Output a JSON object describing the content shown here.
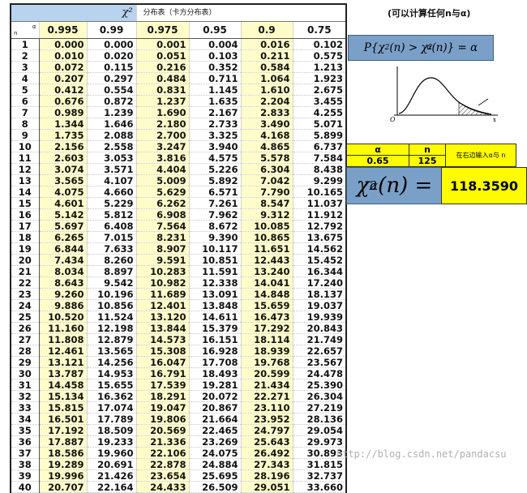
{
  "table": {
    "title_symbol": "χ²",
    "title_text": "分布表（卡方分布表）",
    "header_alpha": "α",
    "header_n": "n",
    "alphas": [
      "0.995",
      "0.99",
      "0.975",
      "0.95",
      "0.9",
      "0.75"
    ],
    "rows": [
      [
        "1",
        "0.000",
        "0.000",
        "0.001",
        "0.004",
        "0.016",
        "0.102"
      ],
      [
        "2",
        "0.010",
        "0.020",
        "0.051",
        "0.103",
        "0.211",
        "0.575"
      ],
      [
        "3",
        "0.072",
        "0.115",
        "0.216",
        "0.352",
        "0.584",
        "1.213"
      ],
      [
        "4",
        "0.207",
        "0.297",
        "0.484",
        "0.711",
        "1.064",
        "1.923"
      ],
      [
        "5",
        "0.412",
        "0.554",
        "0.831",
        "1.145",
        "1.610",
        "2.675"
      ],
      [
        "6",
        "0.676",
        "0.872",
        "1.237",
        "1.635",
        "2.204",
        "3.455"
      ],
      [
        "7",
        "0.989",
        "1.239",
        "1.690",
        "2.167",
        "2.833",
        "4.255"
      ],
      [
        "8",
        "1.344",
        "1.646",
        "2.180",
        "2.733",
        "3.490",
        "5.071"
      ],
      [
        "9",
        "1.735",
        "2.088",
        "2.700",
        "3.325",
        "4.168",
        "5.899"
      ],
      [
        "10",
        "2.156",
        "2.558",
        "3.247",
        "3.940",
        "4.865",
        "6.737"
      ],
      [
        "11",
        "2.603",
        "3.053",
        "3.816",
        "4.575",
        "5.578",
        "7.584"
      ],
      [
        "12",
        "3.074",
        "3.571",
        "4.404",
        "5.226",
        "6.304",
        "8.438"
      ],
      [
        "13",
        "3.565",
        "4.107",
        "5.009",
        "5.892",
        "7.042",
        "9.299"
      ],
      [
        "14",
        "4.075",
        "4.660",
        "5.629",
        "6.571",
        "7.790",
        "10.165"
      ],
      [
        "15",
        "4.601",
        "5.229",
        "6.262",
        "7.261",
        "8.547",
        "11.037"
      ],
      [
        "16",
        "5.142",
        "5.812",
        "6.908",
        "7.962",
        "9.312",
        "11.912"
      ],
      [
        "17",
        "5.697",
        "6.408",
        "7.564",
        "8.672",
        "10.085",
        "12.792"
      ],
      [
        "18",
        "6.265",
        "7.015",
        "8.231",
        "9.390",
        "10.865",
        "13.675"
      ],
      [
        "19",
        "6.844",
        "7.633",
        "8.907",
        "10.117",
        "11.651",
        "14.562"
      ],
      [
        "20",
        "7.434",
        "8.260",
        "9.591",
        "10.851",
        "12.443",
        "15.452"
      ],
      [
        "21",
        "8.034",
        "8.897",
        "10.283",
        "11.591",
        "13.240",
        "16.344"
      ],
      [
        "22",
        "8.643",
        "9.542",
        "10.982",
        "12.338",
        "14.041",
        "17.240"
      ],
      [
        "23",
        "9.260",
        "10.196",
        "11.689",
        "13.091",
        "14.848",
        "18.137"
      ],
      [
        "24",
        "9.886",
        "10.856",
        "12.401",
        "13.848",
        "15.659",
        "19.037"
      ],
      [
        "25",
        "10.520",
        "11.524",
        "13.120",
        "14.611",
        "16.473",
        "19.939"
      ],
      [
        "26",
        "11.160",
        "12.198",
        "13.844",
        "15.379",
        "17.292",
        "20.843"
      ],
      [
        "27",
        "11.808",
        "12.879",
        "14.573",
        "16.151",
        "18.114",
        "21.749"
      ],
      [
        "28",
        "12.461",
        "13.565",
        "15.308",
        "16.928",
        "18.939",
        "22.657"
      ],
      [
        "29",
        "13.121",
        "14.256",
        "16.047",
        "17.708",
        "19.768",
        "23.567"
      ],
      [
        "30",
        "13.787",
        "14.953",
        "16.791",
        "18.493",
        "20.599",
        "24.478"
      ],
      [
        "31",
        "14.458",
        "15.655",
        "17.539",
        "19.281",
        "21.434",
        "25.390"
      ],
      [
        "32",
        "15.134",
        "16.362",
        "18.291",
        "20.072",
        "22.271",
        "26.304"
      ],
      [
        "33",
        "15.815",
        "17.074",
        "19.047",
        "20.867",
        "23.110",
        "27.219"
      ],
      [
        "34",
        "16.501",
        "17.789",
        "19.806",
        "21.664",
        "23.952",
        "28.136"
      ],
      [
        "35",
        "17.192",
        "18.509",
        "20.569",
        "22.465",
        "24.797",
        "29.054"
      ],
      [
        "36",
        "17.887",
        "19.233",
        "21.336",
        "23.269",
        "25.643",
        "29.973"
      ],
      [
        "37",
        "18.586",
        "19.960",
        "22.106",
        "24.075",
        "26.492",
        "30.893"
      ],
      [
        "38",
        "19.289",
        "20.691",
        "22.878",
        "24.884",
        "27.343",
        "31.815"
      ],
      [
        "39",
        "19.996",
        "21.426",
        "23.654",
        "25.695",
        "28.196",
        "32.737"
      ],
      [
        "40",
        "20.707",
        "22.164",
        "24.433",
        "26.509",
        "29.051",
        "33.660"
      ]
    ]
  },
  "side": {
    "hint": "(可以计算任何n与α)",
    "formula": {
      "prefix": "P{χ",
      "mid1": "(n) > χ",
      "mid2": "(n)} = α",
      "sup": "2",
      "sub": "α"
    },
    "plot": {
      "origin": "O",
      "axis_x": "x"
    },
    "calc": {
      "alpha_label": "α",
      "n_label": "n",
      "alpha_value": "0.65",
      "n_value": "125",
      "note": "在右边输入α与 n"
    },
    "chi_label": {
      "chi": "χ",
      "sup": "2",
      "sub": "α",
      "rest": "(n) ="
    },
    "result": "118.3590"
  },
  "watermark": "http://blog.csdn.net/pandacsu",
  "colors": {
    "highlight_column": "#fefcc8",
    "blue_box": "#7ba0c8",
    "yellow": "#fffc00",
    "hatch": "#333333"
  }
}
